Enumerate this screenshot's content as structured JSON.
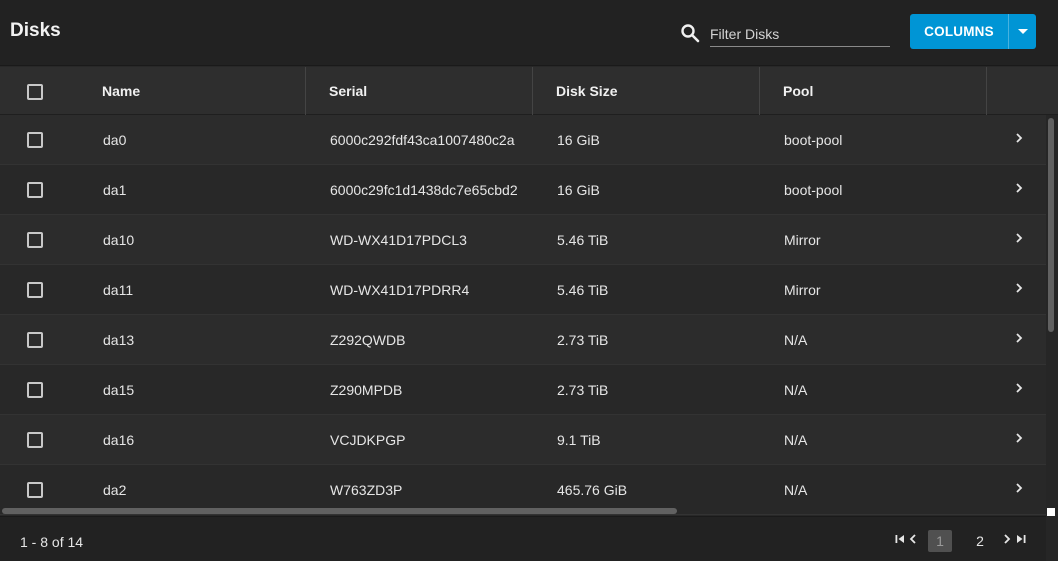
{
  "header": {
    "title": "Disks",
    "filter_placeholder": "Filter Disks",
    "columns_label": "COLUMNS"
  },
  "columns": [
    "Name",
    "Serial",
    "Disk Size",
    "Pool"
  ],
  "rows": [
    {
      "name": "da0",
      "serial": "6000c292fdf43ca1007480c2a",
      "size": "16 GiB",
      "pool": "boot-pool"
    },
    {
      "name": "da1",
      "serial": "6000c29fc1d1438dc7e65cbd2",
      "size": "16 GiB",
      "pool": "boot-pool"
    },
    {
      "name": "da10",
      "serial": "WD-WX41D17PDCL3",
      "size": "5.46 TiB",
      "pool": "Mirror"
    },
    {
      "name": "da11",
      "serial": "WD-WX41D17PDRR4",
      "size": "5.46 TiB",
      "pool": "Mirror"
    },
    {
      "name": "da13",
      "serial": "Z292QWDB",
      "size": "2.73 TiB",
      "pool": "N/A"
    },
    {
      "name": "da15",
      "serial": "Z290MPDB",
      "size": "2.73 TiB",
      "pool": "N/A"
    },
    {
      "name": "da16",
      "serial": "VCJDKPGP",
      "size": "9.1 TiB",
      "pool": "N/A"
    },
    {
      "name": "da2",
      "serial": "W763ZD3P",
      "size": "465.76 GiB",
      "pool": "N/A"
    }
  ],
  "footer": {
    "range": "1 - 8 of 14",
    "pages": [
      "1",
      "2"
    ],
    "current_page": "1"
  },
  "colors": {
    "accent": "#0095d5",
    "background": "#282828",
    "header": "#222222"
  },
  "icons": {
    "search": "search-icon",
    "dropdown": "caret-down-icon",
    "row_expand": "chevron-right-icon",
    "first_page": "first-page-icon",
    "prev_page": "chevron-left-icon",
    "next_page": "chevron-right-icon",
    "last_page": "last-page-icon"
  }
}
